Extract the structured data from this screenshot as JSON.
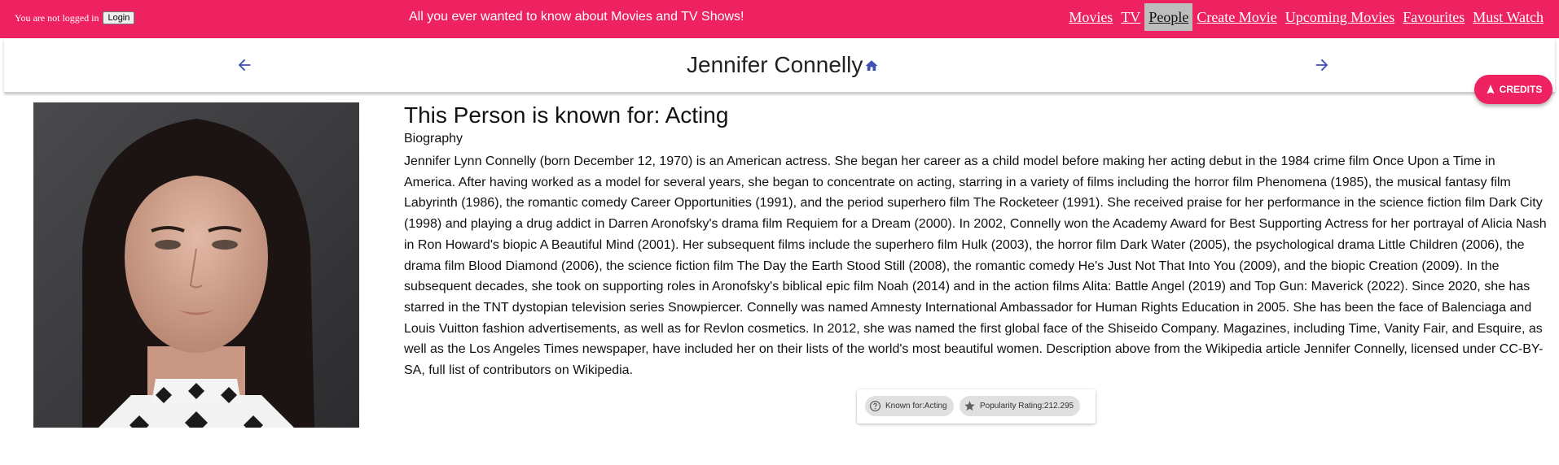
{
  "topbar": {
    "login_status": "You are not logged in",
    "login_button": "Login",
    "tagline": "All you ever wanted to know about Movies and TV Shows!",
    "nav": [
      {
        "label": "Movies",
        "active": false
      },
      {
        "label": "TV",
        "active": false
      },
      {
        "label": "People",
        "active": true
      },
      {
        "label": "Create Movie",
        "active": false
      },
      {
        "label": "Upcoming Movies",
        "active": false
      },
      {
        "label": "Favourites",
        "active": false
      },
      {
        "label": "Must Watch",
        "active": false
      }
    ]
  },
  "header": {
    "name": "Jennifer Connelly",
    "prev_icon": "arrow-left-icon",
    "next_icon": "arrow-right-icon",
    "home_icon": "home-icon"
  },
  "credits_button": "CREDITS",
  "person": {
    "known_for_heading": "This Person is known for: Acting",
    "bio_label": "Biography",
    "biography": "Jennifer Lynn Connelly (born December 12, 1970) is an American actress. She began her career as a child model before making her acting debut in the 1984 crime film Once Upon a Time in America. After having worked as a model for several years, she began to concentrate on acting, starring in a variety of films including the horror film Phenomena (1985), the musical fantasy film Labyrinth (1986), the romantic comedy Career Opportunities (1991), and the period superhero film The Rocketeer (1991). She received praise for her performance in the science fiction film Dark City (1998) and playing a drug addict in Darren Aronofsky's drama film Requiem for a Dream (2000). In 2002, Connelly won the Academy Award for Best Supporting Actress for her portrayal of Alicia Nash in Ron Howard's biopic A Beautiful Mind (2001). Her subsequent films include the superhero film Hulk (2003), the horror film Dark Water (2005), the psychological drama Little Children (2006), the drama film Blood Diamond (2006), the science fiction film The Day the Earth Stood Still (2008), the romantic comedy He's Just Not That Into You (2009), and the biopic Creation (2009). In the subsequent decades, she took on supporting roles in Aronofsky's biblical epic film Noah (2014) and in the action films Alita: Battle Angel (2019) and Top Gun: Maverick (2022). Since 2020, she has starred in the TNT dystopian television series Snowpiercer. Connelly was named Amnesty International Ambassador for Human Rights Education in 2005. She has been the face of Balenciaga and Louis Vuitton fashion advertisements, as well as for Revlon cosmetics. In 2012, she was named the first global face of the Shiseido Company. Magazines, including Time, Vanity Fair, and Esquire, as well as the Los Angeles Times newspaper, have included her on their lists of the world's most beautiful women. Description above from the Wikipedia article Jennifer Connelly, licensed under CC-BY-SA, full list of contributors on Wikipedia.",
    "chips": {
      "known_for": "Known for:Acting",
      "popularity": "Popularity Rating:212.295"
    }
  },
  "colors": {
    "brand": "#ee2161",
    "accent_icon": "#3f51b5",
    "chip_bg": "#e0e0e0"
  }
}
